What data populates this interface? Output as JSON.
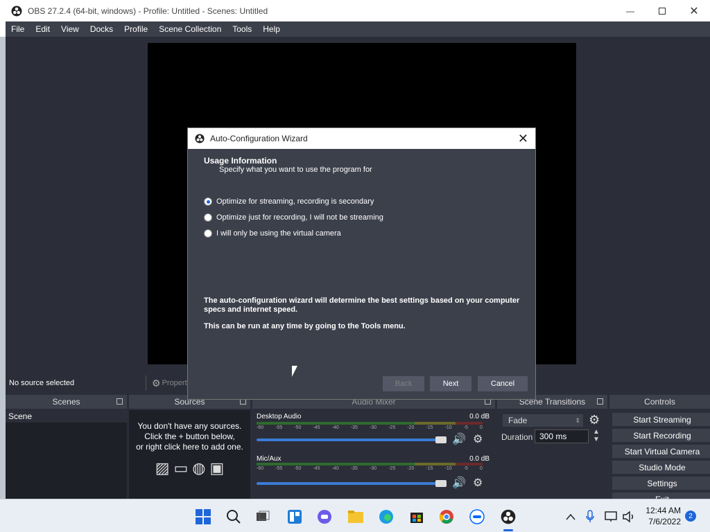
{
  "window": {
    "title": "OBS 27.2.4 (64-bit, windows) - Profile: Untitled - Scenes: Untitled"
  },
  "menu": [
    "File",
    "Edit",
    "View",
    "Docks",
    "Profile",
    "Scene Collection",
    "Tools",
    "Help"
  ],
  "sourcebar": {
    "status": "No source selected",
    "properties": "Properties"
  },
  "docks": {
    "scenes": {
      "title": "Scenes",
      "items": [
        "Scene"
      ]
    },
    "sources": {
      "title": "Sources",
      "empty_line1": "You don't have any sources.",
      "empty_line2": "Click the + button below,",
      "empty_line3": "or right click here to add one."
    },
    "mixer": {
      "title": "Audio Mixer",
      "channels": [
        {
          "name": "Desktop Audio",
          "db": "0.0 dB"
        },
        {
          "name": "Mic/Aux",
          "db": "0.0 dB"
        }
      ],
      "ticks": [
        "-60",
        "-55",
        "-50",
        "-45",
        "-40",
        "-35",
        "-30",
        "-25",
        "-20",
        "-15",
        "-10",
        "-5",
        "0"
      ]
    },
    "transitions": {
      "title": "Scene Transitions",
      "selected": "Fade",
      "duration_label": "Duration",
      "duration_value": "300 ms"
    },
    "controls": {
      "title": "Controls",
      "buttons": [
        "Start Streaming",
        "Start Recording",
        "Start Virtual Camera",
        "Studio Mode",
        "Settings",
        "Exit"
      ]
    }
  },
  "dialog": {
    "title": "Auto-Configuration Wizard",
    "heading": "Usage Information",
    "subheading": "Specify what you want to use the program for",
    "options": [
      {
        "label": "Optimize for streaming, recording is secondary",
        "selected": true
      },
      {
        "label": "Optimize just for recording, I will not be streaming",
        "selected": false
      },
      {
        "label": "I will only be using the virtual camera",
        "selected": false
      }
    ],
    "info1": "The auto-configuration wizard will determine the best settings based on your computer specs and internet speed.",
    "info2": "This can be run at any time by going to the Tools menu.",
    "buttons": {
      "back": "Back",
      "next": "Next",
      "cancel": "Cancel"
    }
  },
  "taskbar": {
    "time": "12:44 AM",
    "date": "7/6/2022",
    "notifications": "2"
  }
}
